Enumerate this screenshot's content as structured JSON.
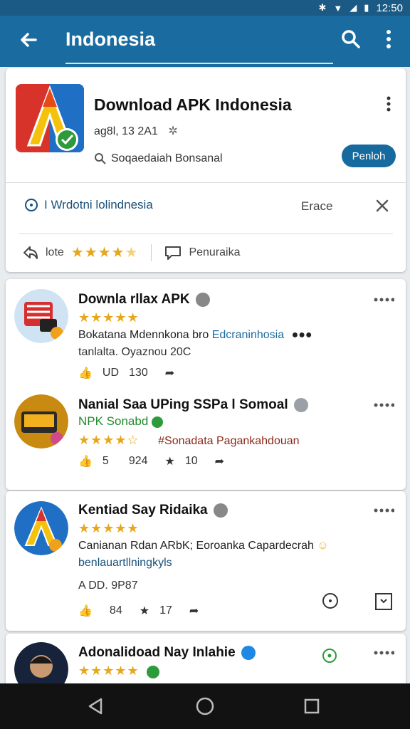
{
  "status_bar": {
    "time": "12:50"
  },
  "app_bar": {
    "title": "Indonesia"
  },
  "app_card": {
    "name": "Download APK Indonesia",
    "meta": "ag8l, 13 2A1",
    "developer": "Soqaedaiah Bonsanal",
    "open_label": "Penloh",
    "info_text": "I Wrdotni lolindnesia",
    "erase_label": "Erace",
    "rating_label": "lote",
    "report_label": "Penuraika"
  },
  "posts": [
    {
      "title": "Downla rllax APK",
      "stars": "★★★★★",
      "line1": "Bokatana Mdennkona bro",
      "line1_highlight": "Edcraninhosia",
      "line2": "tanlalta. Oyaznou 20C",
      "likes": "130",
      "like_prefix": "UD"
    },
    {
      "title": "Nanial Saa UPing SSPa l Somoal",
      "subtitle": "NPK Sonabd",
      "stars": "★★★★☆",
      "line1": "#Sonadata Pagankahdouan",
      "likes": "5",
      "comments": "924",
      "shares": "10"
    },
    {
      "title": "Kentiad Say Ridaika",
      "stars": "★★★★★",
      "line1": "Canianan Rdan ARbK; Eoroanka Capardecrah",
      "line2": "benlauartllningkyls",
      "line3": "A DD. 9P87",
      "likes": "84",
      "shares": "17"
    },
    {
      "title": "Adonalidoad Nay Inlahie",
      "stars": "★★★★★"
    }
  ],
  "colors": {
    "app_bar": "#1a6ca0",
    "accent": "#176a9e",
    "star": "#e7a71c"
  }
}
